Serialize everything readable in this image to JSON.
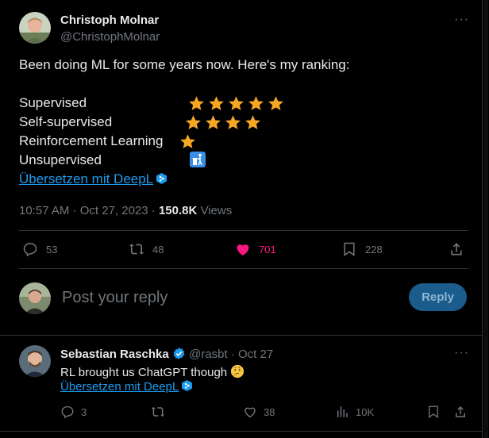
{
  "tweet": {
    "author_name": "Christoph Molnar",
    "author_handle": "@ChristophMolnar",
    "more": "···",
    "text": "Been doing ML for some years now. Here's my ranking:",
    "ranking": [
      {
        "label": "Supervised",
        "stars": 5
      },
      {
        "label": "Self-supervised",
        "stars": 4
      },
      {
        "label": "Reinforcement Learning",
        "stars": 1
      },
      {
        "label": "Unsupervised",
        "stars": 0,
        "emoji": "trash-can-icon"
      }
    ],
    "translate": "Übersetzen mit DeepL",
    "time": "10:57 AM · Oct 27, 2023 · ",
    "views_count": "150.8K",
    "views_label": " Views",
    "actions": {
      "replies": "53",
      "retweets": "48",
      "likes": "701",
      "bookmarks": "228"
    }
  },
  "compose": {
    "placeholder": "Post your reply",
    "reply_button": "Reply"
  },
  "reply": {
    "author_name": "Sebastian Raschka",
    "author_handle": "@rasbt",
    "date": " · Oct 27",
    "more": "···",
    "text": "RL brought us ChatGPT though",
    "translate": "Übersetzen mit DeepL",
    "actions": {
      "replies": "3",
      "retweets": "",
      "likes": "38",
      "views": "10K"
    }
  },
  "colors": {
    "star": "#f5a623",
    "like": "#f91880",
    "link": "#1d9bf0",
    "muted": "#71767b",
    "verified": "#1d9bf0"
  }
}
